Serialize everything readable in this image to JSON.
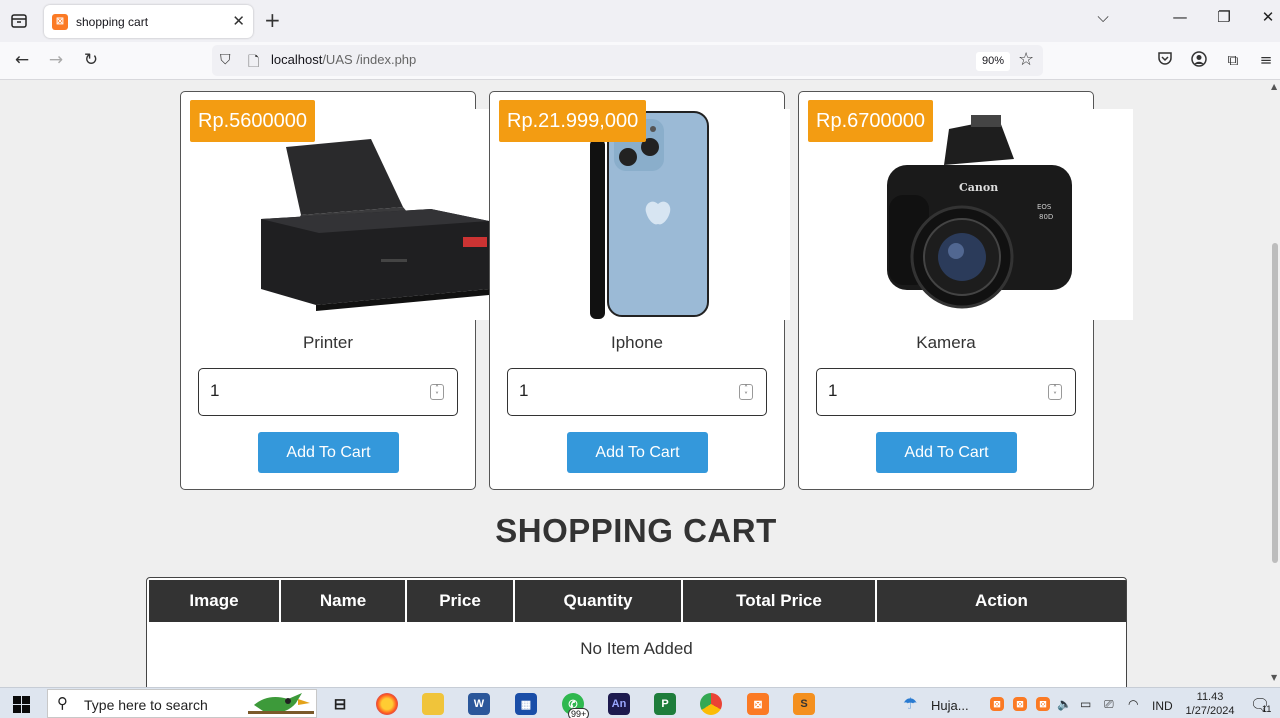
{
  "browser": {
    "tab_title": "shopping cart",
    "url_host": "localhost",
    "url_path": "/UAS /index.php",
    "zoom": "90%"
  },
  "products": [
    {
      "name": "Printer",
      "price": "Rp.5600000",
      "quantity": "1",
      "button": "Add To Cart",
      "image_icon": "printer-image"
    },
    {
      "name": "Iphone",
      "price": "Rp.21.999,000",
      "quantity": "1",
      "button": "Add To Cart",
      "image_icon": "iphone-image"
    },
    {
      "name": "Kamera",
      "price": "Rp.6700000",
      "quantity": "1",
      "button": "Add To Cart",
      "image_icon": "camera-image"
    }
  ],
  "cart": {
    "title": "SHOPPING CART",
    "columns": [
      "Image",
      "Name",
      "Price",
      "Quantity",
      "Total Price",
      "Action"
    ],
    "empty_message": "No Item Added"
  },
  "taskbar": {
    "search_placeholder": "Type here to search",
    "whatsapp_badge": "99+",
    "weather_text": "Huja...",
    "language": "IND",
    "time": "11.43",
    "date": "1/27/2024",
    "notification_count": "11"
  },
  "colors": {
    "price_badge": "#f39c12",
    "add_button": "#3498db",
    "table_header": "#333333"
  }
}
